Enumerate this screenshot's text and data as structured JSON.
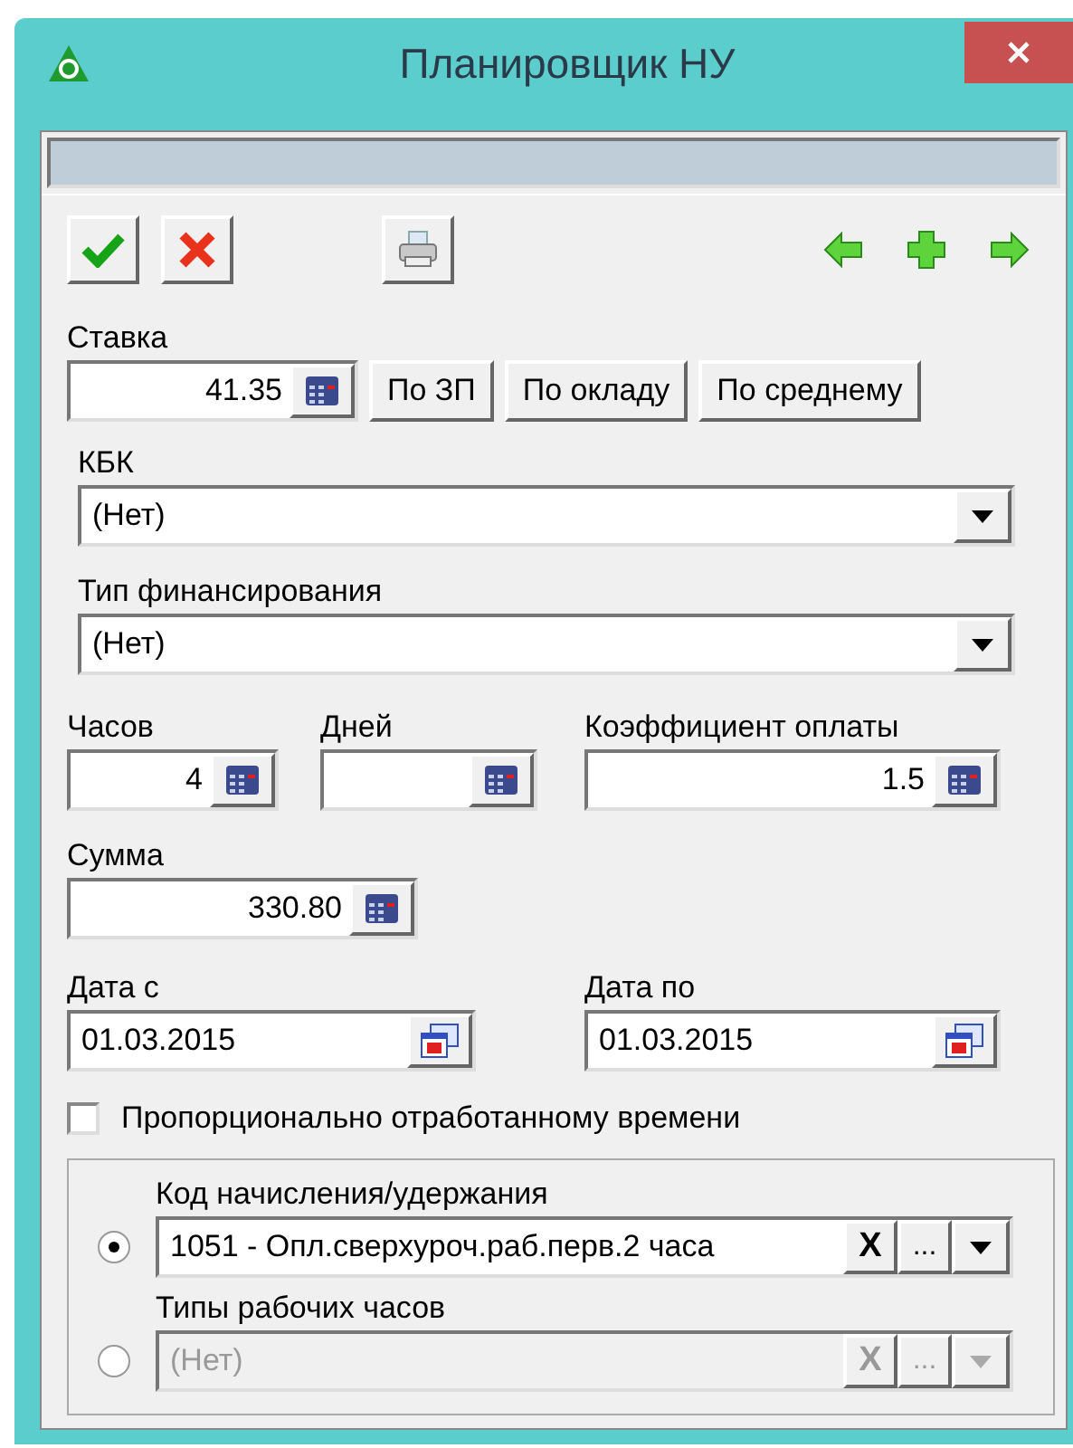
{
  "window": {
    "title": "Планировщик НУ"
  },
  "rate": {
    "label": "Ставка",
    "value": "41.35",
    "buttons": [
      "По ЗП",
      "По окладу",
      "По среднему"
    ]
  },
  "kbk": {
    "label": "КБК",
    "value": "(Нет)"
  },
  "financing": {
    "label": "Тип финансирования",
    "value": "(Нет)"
  },
  "quantities": [
    {
      "label": "Часов",
      "value": "4"
    },
    {
      "label": "Дней"
    },
    {
      "label": "Коэффициент оплаты",
      "value": "1.5"
    }
  ],
  "sum": {
    "label": "Сумма",
    "value": "330.80"
  },
  "dates": [
    {
      "label": "Дата с",
      "value": "01.03.2015"
    },
    {
      "label": "Дата по",
      "value": "01.03.2015"
    }
  ],
  "proportional": {
    "label": "Пропорционально отработанному времени",
    "checked": false
  },
  "source": [
    {
      "label": "Код начисления/удержания",
      "value": "1051 - Опл.сверхуроч.раб.перв.2 часа",
      "selected": true,
      "clear": "X",
      "more": "..."
    },
    {
      "label": "Типы рабочих часов",
      "value": "(Нет)",
      "selected": false,
      "clear": "X",
      "more": "..."
    }
  ]
}
